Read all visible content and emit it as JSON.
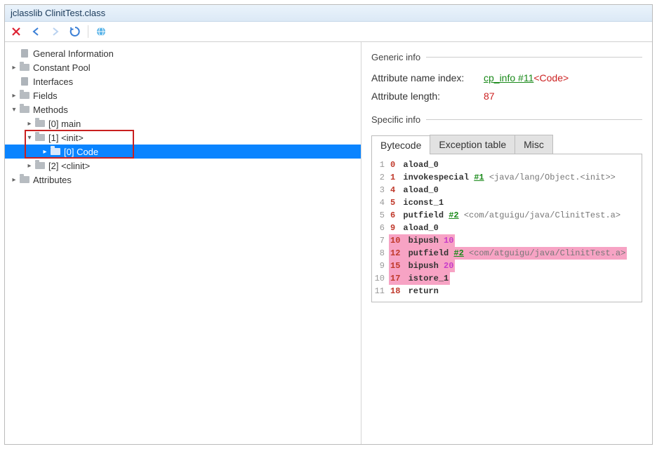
{
  "title": "jclasslib ClinitTest.class",
  "toolbar": {
    "icons": [
      "close",
      "back",
      "forward",
      "refresh",
      "globe"
    ]
  },
  "tree": [
    {
      "label": "General Information",
      "level": 0,
      "chev": "",
      "icon": "file"
    },
    {
      "label": "Constant Pool",
      "level": 0,
      "chev": "right",
      "icon": "folder"
    },
    {
      "label": "Interfaces",
      "level": 0,
      "chev": "",
      "icon": "file"
    },
    {
      "label": "Fields",
      "level": 0,
      "chev": "right",
      "icon": "folder"
    },
    {
      "label": "Methods",
      "level": 0,
      "chev": "down",
      "icon": "folder"
    },
    {
      "label": "[0] main",
      "level": 1,
      "chev": "right",
      "icon": "folder"
    },
    {
      "label": "[1] <init>",
      "level": 1,
      "chev": "down",
      "icon": "folder",
      "boxtop": true
    },
    {
      "label": "[0] Code",
      "level": 2,
      "chev": "right",
      "icon": "folder",
      "selected": true,
      "boxbot": true
    },
    {
      "label": "[2] <clinit>",
      "level": 1,
      "chev": "right",
      "icon": "folder"
    },
    {
      "label": "Attributes",
      "level": 0,
      "chev": "right",
      "icon": "folder"
    }
  ],
  "generic": {
    "header": "Generic info",
    "rows": [
      {
        "k": "Attribute name index:",
        "link": "cp_info #11",
        "red": "<Code>"
      },
      {
        "k": "Attribute length:",
        "red": "87"
      }
    ]
  },
  "specific": {
    "header": "Specific info"
  },
  "tabs": [
    "Bytecode",
    "Exception table",
    "Misc"
  ],
  "activeTab": 0,
  "bytecode": [
    {
      "n": 1,
      "off": "0",
      "op": "aload_0"
    },
    {
      "n": 2,
      "off": "1",
      "op": "invokespecial",
      "ref": "#1",
      "cmt": "<java/lang/Object.<init>>"
    },
    {
      "n": 3,
      "off": "4",
      "op": "aload_0"
    },
    {
      "n": 4,
      "off": "5",
      "op": "iconst_1"
    },
    {
      "n": 5,
      "off": "6",
      "op": "putfield",
      "ref": "#2",
      "cmt": "<com/atguigu/java/ClinitTest.a>"
    },
    {
      "n": 6,
      "off": "9",
      "op": "aload_0"
    },
    {
      "n": 7,
      "off": "10",
      "op": "bipush",
      "num": "10",
      "hl": true
    },
    {
      "n": 8,
      "off": "12",
      "op": "putfield",
      "ref": "#2",
      "cmt": "<com/atguigu/java/ClinitTest.a>",
      "hl": true
    },
    {
      "n": 9,
      "off": "15",
      "op": "bipush",
      "num": "20",
      "hl": true
    },
    {
      "n": 10,
      "off": "17",
      "op": "istore_1",
      "hl": true
    },
    {
      "n": 11,
      "off": "18",
      "op": "return"
    }
  ]
}
